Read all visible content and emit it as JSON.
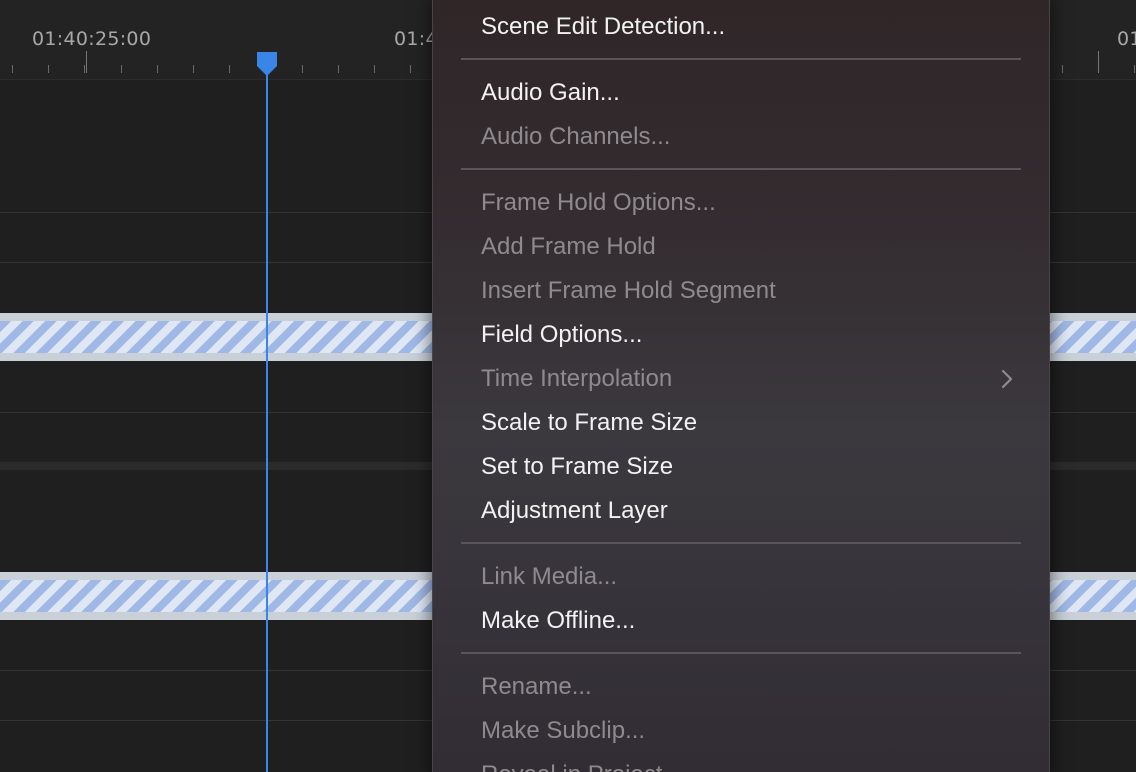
{
  "timeline": {
    "timecodes": [
      "01:40:25:00",
      "01:4",
      "01"
    ],
    "playhead_color": "#3a86e8"
  },
  "context_menu": {
    "items": [
      {
        "label": "Scene Edit Detection...",
        "enabled": true
      },
      {
        "label": "Audio Gain...",
        "enabled": true
      },
      {
        "label": "Audio Channels...",
        "enabled": false
      },
      {
        "label": "Frame Hold Options...",
        "enabled": false
      },
      {
        "label": "Add Frame Hold",
        "enabled": false
      },
      {
        "label": "Insert Frame Hold Segment",
        "enabled": false
      },
      {
        "label": "Field Options...",
        "enabled": true
      },
      {
        "label": "Time Interpolation",
        "enabled": false,
        "submenu": true
      },
      {
        "label": "Scale to Frame Size",
        "enabled": true
      },
      {
        "label": "Set to Frame Size",
        "enabled": true
      },
      {
        "label": "Adjustment Layer",
        "enabled": true
      },
      {
        "label": "Link Media...",
        "enabled": false
      },
      {
        "label": "Make Offline...",
        "enabled": true
      },
      {
        "label": "Rename...",
        "enabled": false
      },
      {
        "label": "Make Subclip...",
        "enabled": false
      },
      {
        "label": "Reveal in Project",
        "enabled": false
      }
    ],
    "submenu_icon": "chevron-right-icon"
  }
}
